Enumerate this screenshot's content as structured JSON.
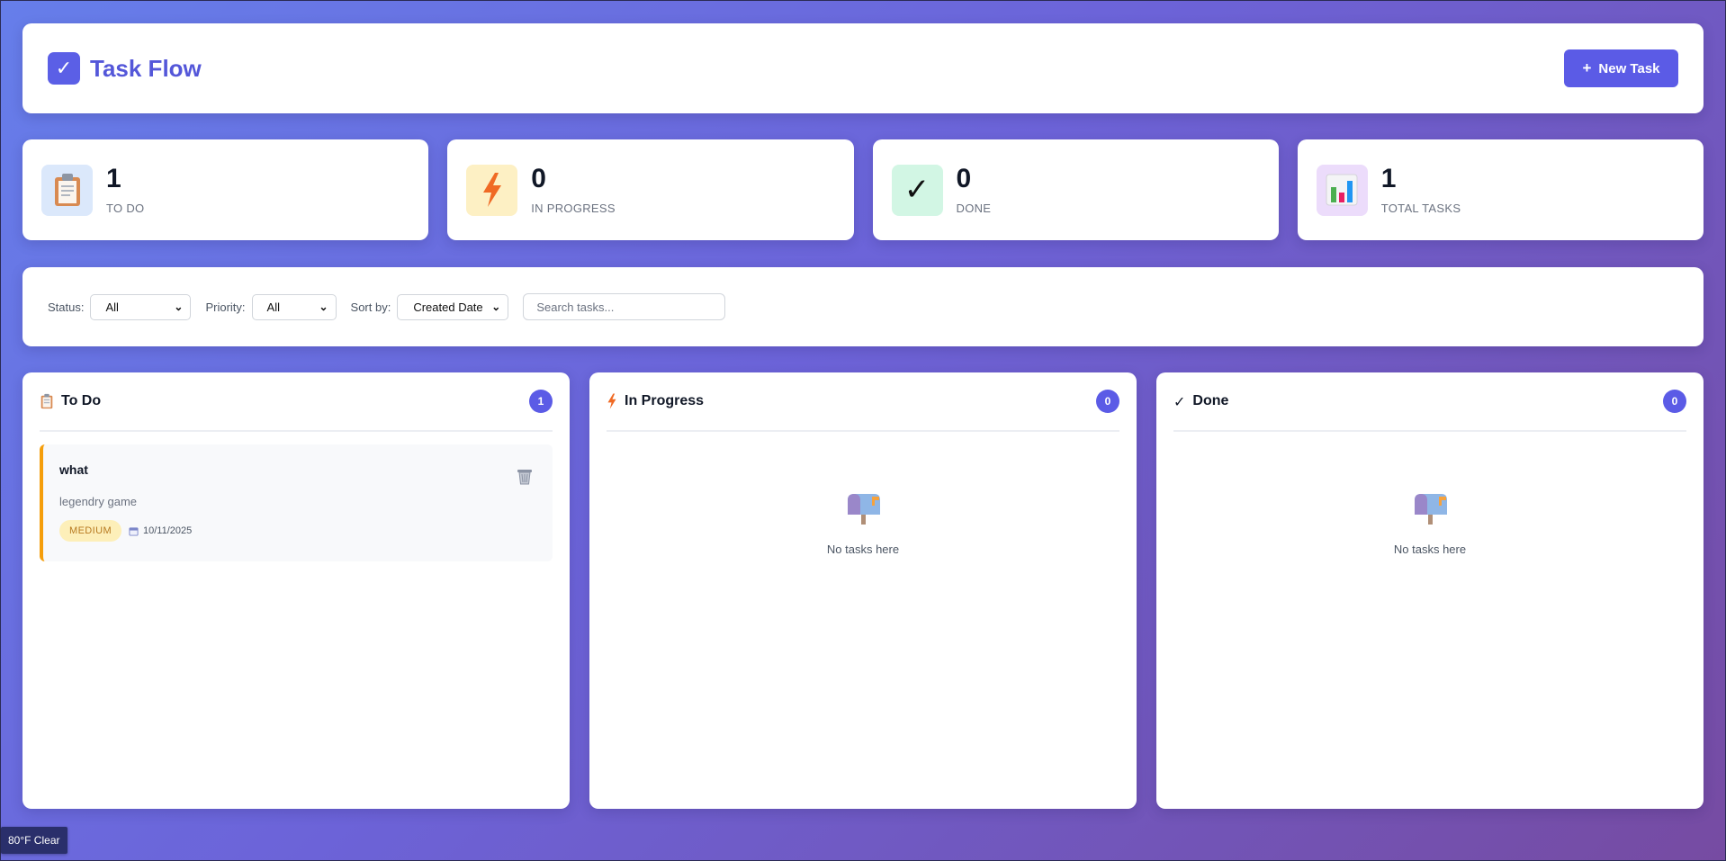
{
  "header": {
    "title": "Task Flow",
    "logo_icon": "check-icon",
    "new_task_label": "New Task"
  },
  "stats": [
    {
      "value": "1",
      "label": "TO DO",
      "icon": "clipboard-icon",
      "bg": "#dbe8fb"
    },
    {
      "value": "0",
      "label": "IN PROGRESS",
      "icon": "lightning-icon",
      "bg": "#fdf0c4"
    },
    {
      "value": "0",
      "label": "DONE",
      "icon": "checkmark-icon",
      "bg": "#d2f6e4"
    },
    {
      "value": "1",
      "label": "TOTAL TASKS",
      "icon": "bar-chart-icon",
      "bg": "#ecdcfb"
    }
  ],
  "filters": {
    "status_label": "Status:",
    "status_value": "All",
    "priority_label": "Priority:",
    "priority_value": "All",
    "sort_label": "Sort by:",
    "sort_value": "Created Date",
    "search_placeholder": "Search tasks..."
  },
  "columns": [
    {
      "title": "To Do",
      "icon": "clipboard-icon",
      "count": "1",
      "tasks": [
        {
          "title": "what",
          "description": "legendry game",
          "priority": "MEDIUM",
          "date": "10/11/2025"
        }
      ]
    },
    {
      "title": "In Progress",
      "icon": "lightning-icon",
      "count": "0",
      "empty_text": "No tasks here"
    },
    {
      "title": "Done",
      "icon": "checkmark-icon",
      "count": "0",
      "empty_text": "No tasks here"
    }
  ],
  "weather": "80°F Clear",
  "colors": {
    "accent": "#5b5be6",
    "medium_priority": "#f59e0b"
  }
}
